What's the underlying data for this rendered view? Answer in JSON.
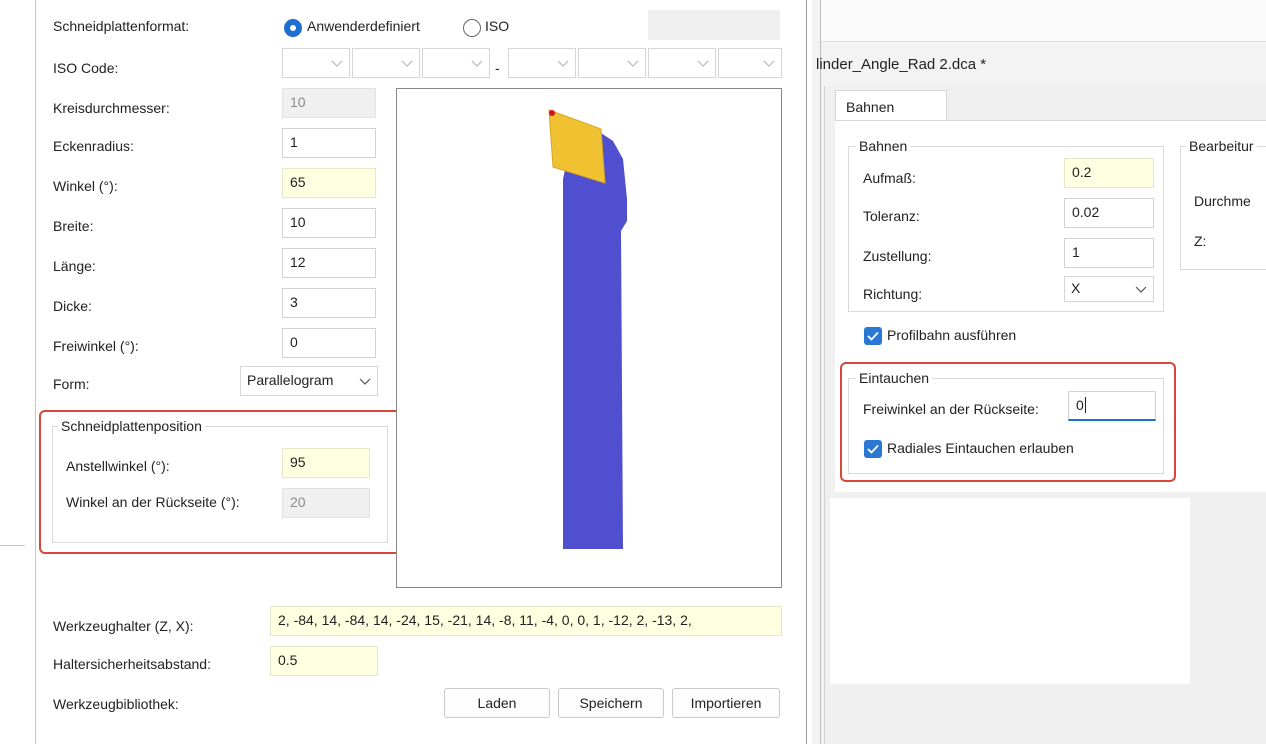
{
  "left": {
    "schneidplattenformat": {
      "label": "Schneidplattenformat:",
      "options": [
        "Anwenderdefiniert",
        "ISO"
      ],
      "selected": "Anwenderdefiniert"
    },
    "iso_code": {
      "label": "ISO Code:",
      "separator": "-"
    },
    "params": [
      {
        "label": "Kreisdurchmesser:",
        "value": "10",
        "state": "disabled"
      },
      {
        "label": "Eckenradius:",
        "value": "1",
        "state": "normal"
      },
      {
        "label": "Winkel (°):",
        "value": "65",
        "state": "yellow"
      },
      {
        "label": "Breite:",
        "value": "10",
        "state": "normal"
      },
      {
        "label": "Länge:",
        "value": "12",
        "state": "normal"
      },
      {
        "label": "Dicke:",
        "value": "3",
        "state": "normal"
      },
      {
        "label": "Freiwinkel  (°):",
        "value": "0",
        "state": "normal"
      }
    ],
    "form": {
      "label": "Form:",
      "value": "Parallelogram"
    },
    "position_group": {
      "title": "Schneidplattenposition",
      "anstellwinkel": {
        "label": "Anstellwinkel (°):",
        "value": "95"
      },
      "rueckseite": {
        "label": "Winkel an der Rückseite (°):",
        "value": "20"
      }
    },
    "werkzeughalter": {
      "label": "Werkzeughalter (Z, X):",
      "value": "2, -84, 14, -84, 14, -24, 15, -21, 14, -8, 11, -4, 0, 0, 1, -12, 2, -13, 2,"
    },
    "haltersicherheitsabstand": {
      "label": "Haltersicherheitsabstand:",
      "value": "0.5"
    },
    "werkzeugbibliothek": {
      "label": "Werkzeugbibliothek:",
      "buttons": {
        "laden": "Laden",
        "speichern": "Speichern",
        "importieren": "Importieren"
      }
    }
  },
  "preview": {
    "insert_color": "#f0c232",
    "holder_color": "#4f4fcf"
  },
  "right": {
    "title": "linder_Angle_Rad 2.dca *",
    "tab": "Bahnen",
    "bahnen_group": {
      "title": "Bahnen",
      "aufmass": {
        "label": "Aufmaß:",
        "value": "0.2"
      },
      "toleranz": {
        "label": "Toleranz:",
        "value": "0.02"
      },
      "zustellung": {
        "label": "Zustellung:",
        "value": "1"
      },
      "richtung": {
        "label": "Richtung:",
        "value": "X"
      },
      "profilbahn": {
        "label": "Profilbahn ausführen",
        "checked": true
      }
    },
    "bearbeitung_group": {
      "title": "Bearbeitur",
      "durchmesser_label": "Durchme",
      "z_label": "Z:"
    },
    "eintauchen_group": {
      "title": "Eintauchen",
      "freiwinkel": {
        "label": "Freiwinkel an der Rückseite:",
        "value": "0"
      },
      "radial": {
        "label": "Radiales Eintauchen erlauben",
        "checked": true
      }
    }
  },
  "colors": {
    "accent": "#1f6fd1",
    "highlight_red": "#d7473a",
    "input_yellow": "#ffffe1"
  }
}
